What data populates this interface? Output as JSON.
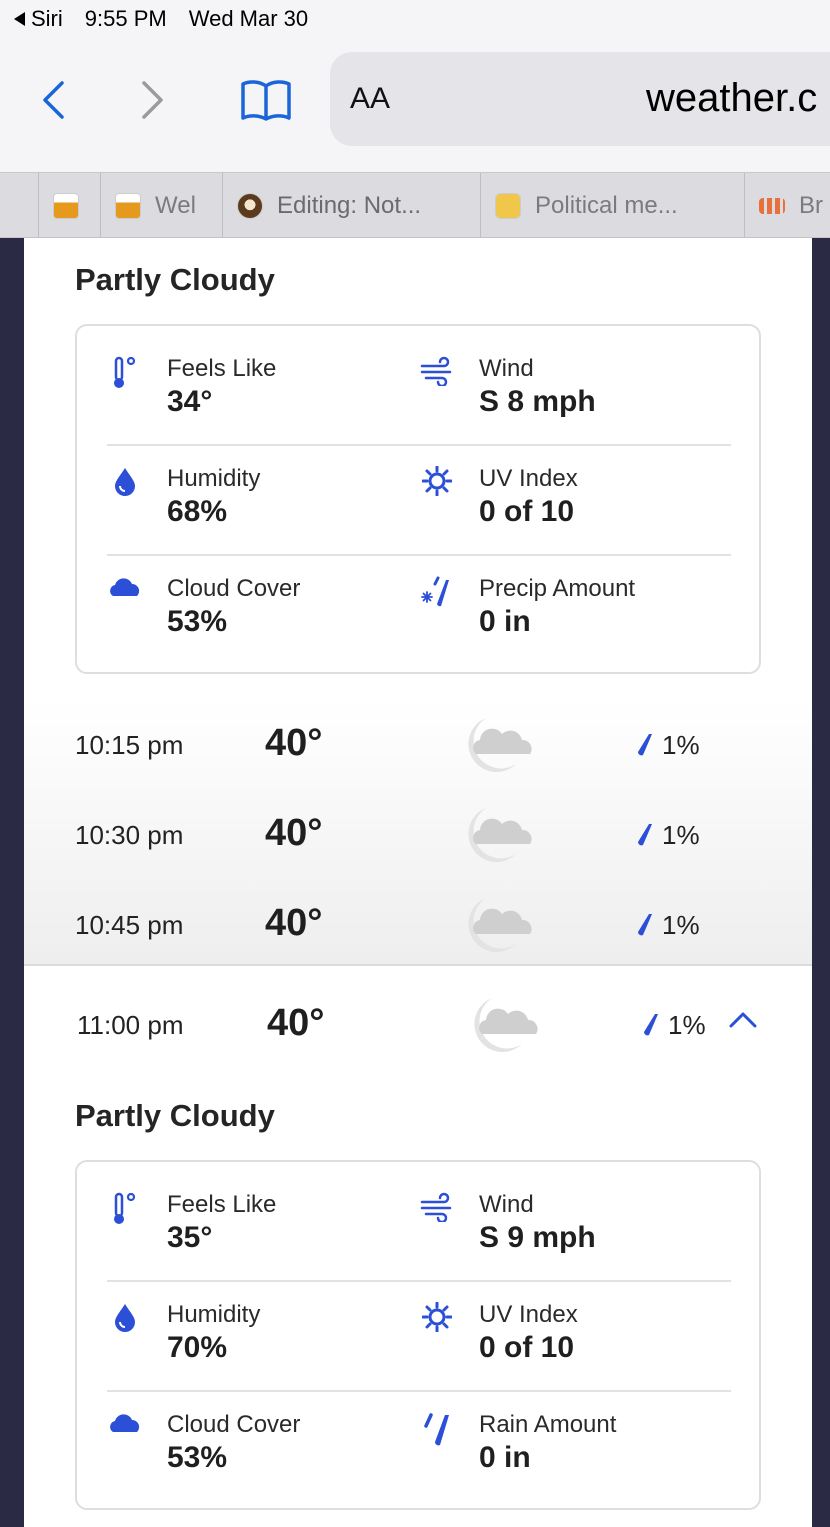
{
  "status_bar": {
    "back_app": "Siri",
    "time": "9:55 PM",
    "date": "Wed Mar 30"
  },
  "browser": {
    "aa_label": "AA",
    "url": "weather.c",
    "tabs": [
      {
        "label": ""
      },
      {
        "label": "Wel"
      },
      {
        "label": "Editing: Not..."
      },
      {
        "label": "Political me..."
      },
      {
        "label": "Br"
      }
    ]
  },
  "blocks": [
    {
      "condition": "Partly Cloudy",
      "details": {
        "feels_like": {
          "label": "Feels Like",
          "value": "34°"
        },
        "wind": {
          "label": "Wind",
          "value": "S 8 mph"
        },
        "humidity": {
          "label": "Humidity",
          "value": "68%"
        },
        "uv": {
          "label": "UV Index",
          "value": "0 of 10"
        },
        "cloud": {
          "label": "Cloud Cover",
          "value": "53%"
        },
        "precip": {
          "label": "Precip Amount",
          "value": "0 in",
          "icon": "snow-rain-icon"
        }
      }
    },
    {
      "condition": "Partly Cloudy",
      "details": {
        "feels_like": {
          "label": "Feels Like",
          "value": "35°"
        },
        "wind": {
          "label": "Wind",
          "value": "S 9 mph"
        },
        "humidity": {
          "label": "Humidity",
          "value": "70%"
        },
        "uv": {
          "label": "UV Index",
          "value": "0 of 10"
        },
        "cloud": {
          "label": "Cloud Cover",
          "value": "53%"
        },
        "precip": {
          "label": "Rain Amount",
          "value": "0 in",
          "icon": "rain-icon"
        }
      }
    }
  ],
  "hours": [
    {
      "time": "10:15 pm",
      "temp": "40°",
      "precip": "1%"
    },
    {
      "time": "10:30 pm",
      "temp": "40°",
      "precip": "1%"
    },
    {
      "time": "10:45 pm",
      "temp": "40°",
      "precip": "1%"
    },
    {
      "time": "11:00 pm",
      "temp": "40°",
      "precip": "1%"
    }
  ],
  "colors": {
    "accent": "#2b4fd6",
    "link": "#1a66d8",
    "icon_gray": "#d6d6d6"
  }
}
